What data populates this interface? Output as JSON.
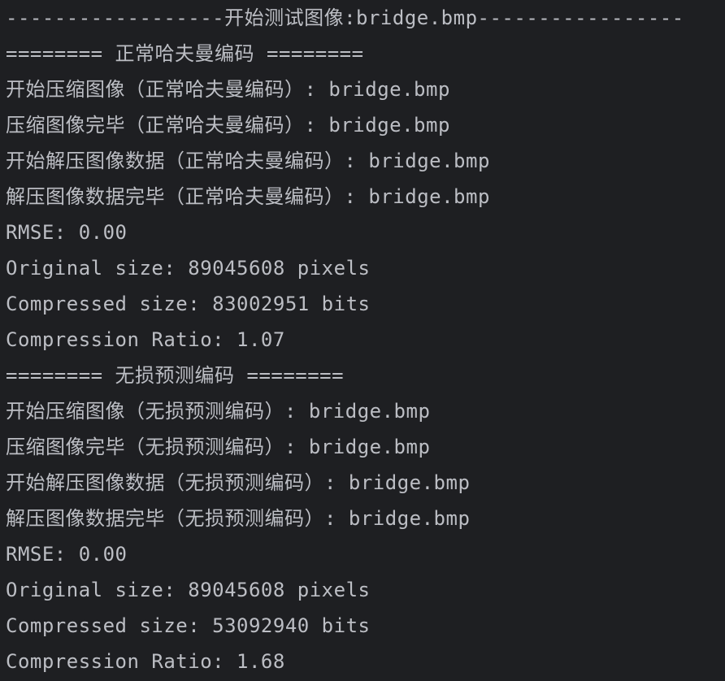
{
  "console": {
    "lines": [
      "------------------开始测试图像:bridge.bmp-----------------",
      "======== 正常哈夫曼编码 ========",
      "开始压缩图像（正常哈夫曼编码）: bridge.bmp",
      "压缩图像完毕（正常哈夫曼编码）: bridge.bmp",
      "开始解压图像数据（正常哈夫曼编码）: bridge.bmp",
      "解压图像数据完毕（正常哈夫曼编码）: bridge.bmp",
      "RMSE: 0.00",
      "Original size: 89045608 pixels",
      "Compressed size: 83002951 bits",
      "Compression Ratio: 1.07",
      "======== 无损预测编码 ========",
      "开始压缩图像（无损预测编码）: bridge.bmp",
      "压缩图像完毕（无损预测编码）: bridge.bmp",
      "开始解压图像数据（无损预测编码）: bridge.bmp",
      "解压图像数据完毕（无损预测编码）: bridge.bmp",
      "RMSE: 0.00",
      "Original size: 89045608 pixels",
      "Compressed size: 53092940 bits",
      "Compression Ratio: 1.68"
    ]
  }
}
